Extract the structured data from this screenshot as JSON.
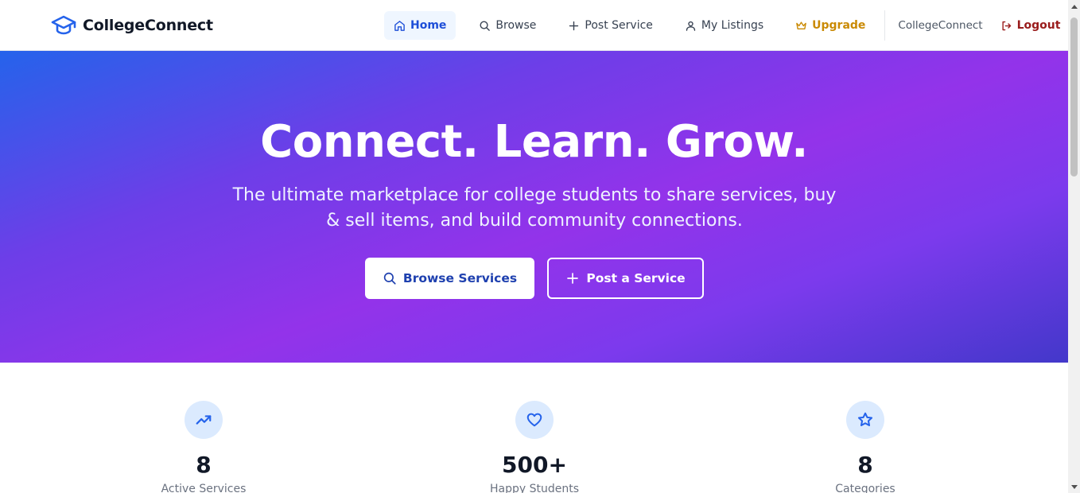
{
  "brand": {
    "name": "CollegeConnect",
    "icon": "graduation-cap-icon",
    "color": "#2563eb"
  },
  "nav": {
    "items": [
      {
        "label": "Home",
        "icon": "home-icon",
        "active": true
      },
      {
        "label": "Browse",
        "icon": "search-icon"
      },
      {
        "label": "Post Service",
        "icon": "plus-icon"
      },
      {
        "label": "My Listings",
        "icon": "user-icon"
      }
    ],
    "upgrade": {
      "label": "Upgrade",
      "icon": "crown-icon",
      "color": "#ca8a04"
    },
    "user_name": "CollegeConnect",
    "logout": {
      "label": "Logout",
      "icon": "logout-icon",
      "color": "#991b1b"
    }
  },
  "hero": {
    "title": "Connect. Learn. Grow.",
    "subtitle": "The ultimate marketplace for college students to share services, buy & sell items, and build community connections.",
    "primary_button": "Browse Services",
    "secondary_button": "Post a Service",
    "gradient_colors": [
      "#2563eb",
      "#9333ea",
      "#4338ca"
    ]
  },
  "stats": [
    {
      "value": "8",
      "label": "Active Services",
      "icon": "trending-up-icon"
    },
    {
      "value": "500+",
      "label": "Happy Students",
      "icon": "heart-icon"
    },
    {
      "value": "8",
      "label": "Categories",
      "icon": "star-icon"
    }
  ]
}
